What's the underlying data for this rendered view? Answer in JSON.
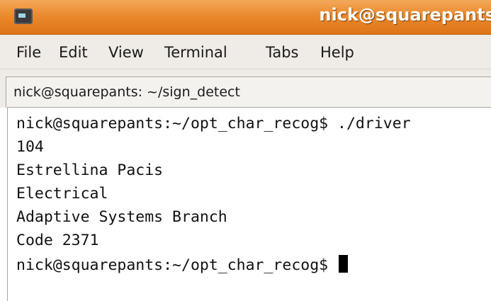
{
  "window": {
    "title": "nick@squarepants"
  },
  "menu": {
    "items": [
      "File",
      "Edit",
      "View",
      "Terminal",
      "Tabs",
      "Help"
    ]
  },
  "tab": {
    "label": "nick@squarepants: ~/sign_detect"
  },
  "terminal": {
    "lines": [
      "nick@squarepants:~/opt_char_recog$ ./driver",
      "104",
      "Estrellina Pacis",
      "Electrical",
      "Adaptive Systems Branch",
      "Code 2371"
    ],
    "prompt": "nick@squarepants:~/opt_char_recog$ "
  },
  "colors": {
    "titlebar": "#ea8a2e",
    "menubar": "#efebe6",
    "terminal_bg": "#ffffff",
    "terminal_fg": "#111111"
  },
  "icons": {
    "app": "terminal-icon"
  }
}
